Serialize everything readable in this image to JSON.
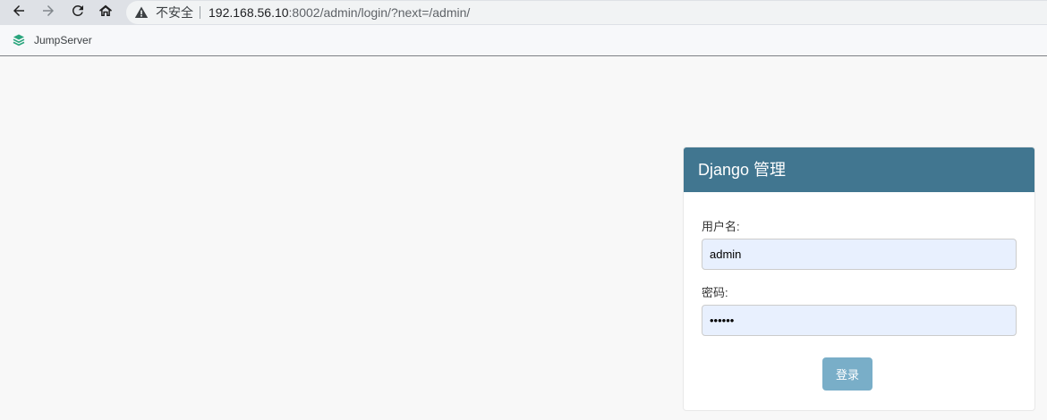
{
  "browser": {
    "back_icon": "arrow-left-icon",
    "forward_icon": "arrow-right-icon",
    "reload_icon": "reload-icon",
    "home_icon": "home-icon",
    "security_icon": "warning-triangle-icon",
    "security_label": "不安全",
    "url_host": "192.168.56.10",
    "url_rest": ":8002/admin/login/?next=/admin/"
  },
  "bookmarks": {
    "items": [
      {
        "label": "JumpServer",
        "icon": "jumpserver-logo-icon"
      }
    ]
  },
  "login": {
    "title": "Django 管理",
    "username_label": "用户名:",
    "username_value": "admin",
    "password_label": "密码:",
    "password_value": "••••••",
    "submit_label": "登录"
  },
  "colors": {
    "header_bg": "#417690",
    "button_bg": "#79aec8",
    "input_autofill_bg": "#e8f0fe",
    "page_bg": "#f8f8f8",
    "logo_green": "#2aa57d"
  }
}
